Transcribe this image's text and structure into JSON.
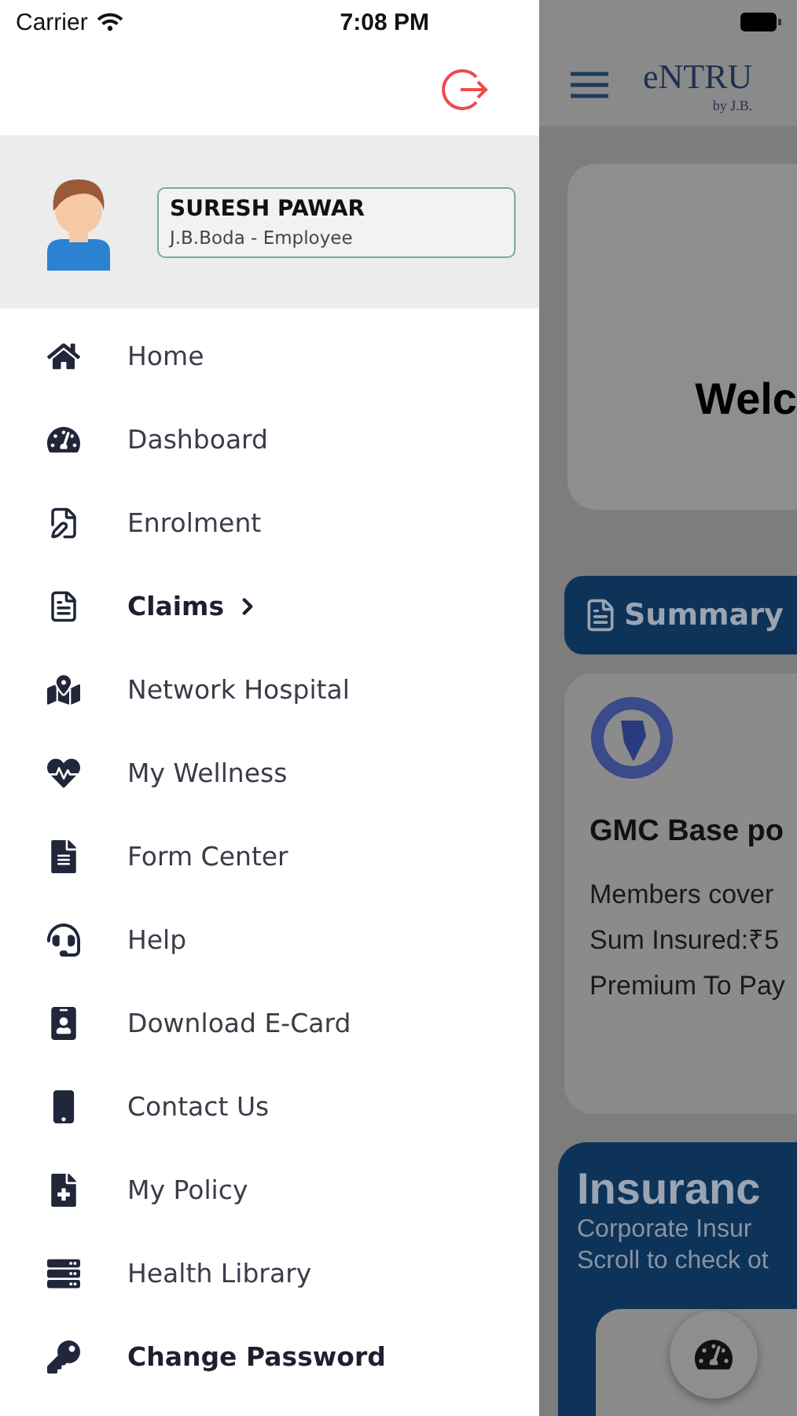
{
  "status_bar": {
    "carrier": "Carrier",
    "time": "7:08 PM"
  },
  "profile": {
    "name": "SURESH PAWAR",
    "role": "J.B.Boda - Employee"
  },
  "menu": [
    {
      "label": "Home",
      "emphasized": false,
      "expandable": false
    },
    {
      "label": "Dashboard",
      "emphasized": false,
      "expandable": false
    },
    {
      "label": "Enrolment",
      "emphasized": false,
      "expandable": false
    },
    {
      "label": "Claims",
      "emphasized": true,
      "expandable": true
    },
    {
      "label": "Network Hospital",
      "emphasized": false,
      "expandable": false
    },
    {
      "label": "My Wellness",
      "emphasized": false,
      "expandable": false
    },
    {
      "label": "Form Center",
      "emphasized": false,
      "expandable": false
    },
    {
      "label": "Help",
      "emphasized": false,
      "expandable": false
    },
    {
      "label": "Download E-Card",
      "emphasized": false,
      "expandable": false
    },
    {
      "label": "Contact Us",
      "emphasized": false,
      "expandable": false
    },
    {
      "label": "My Policy",
      "emphasized": false,
      "expandable": false
    },
    {
      "label": "Health Library",
      "emphasized": false,
      "expandable": false
    },
    {
      "label": "Change Password",
      "emphasized": true,
      "expandable": false
    }
  ],
  "background_app": {
    "logo": "eNTRU",
    "logo_sub": "by J.B.",
    "welcome": "Welc",
    "summary_tab": "Summary",
    "policy_card": {
      "title": "GMC Base po",
      "lines": [
        "Members cover",
        "Sum Insured:₹5",
        "Premium To Pay"
      ]
    },
    "insurance_card": {
      "title": "Insuranc",
      "lines": [
        "Corporate Insur",
        "Scroll to check ot"
      ]
    }
  }
}
